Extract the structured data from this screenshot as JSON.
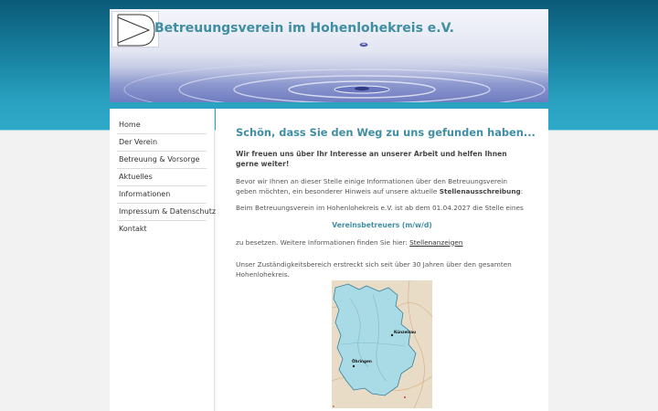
{
  "header": {
    "title": "Betreuungsverein im Hohenlohekreis e.V."
  },
  "nav": {
    "items": [
      {
        "label": "Home"
      },
      {
        "label": "Der Verein"
      },
      {
        "label": "Betreuung & Vorsorge"
      },
      {
        "label": "Aktuelles"
      },
      {
        "label": "Informationen"
      },
      {
        "label": "Impressum & Datenschutz"
      },
      {
        "label": "Kontakt"
      }
    ]
  },
  "main": {
    "heading": "Schön, dass Sie den Weg zu uns gefunden haben...",
    "lead": "Wir freuen uns über Ihr Interesse an unserer Arbeit und helfen Ihnen gerne weiter!",
    "para1_text": "Bevor wir Ihnen an dieser Stelle einige Informationen über den Betreuungsverein geben möchten, ein besonderer Hinweis auf unsere aktuelle ",
    "para1_bold": "Stellenausschreibung",
    "para1_end": ":",
    "para2": "Beim Betreuungsverein im Hohenlohekreis e.V. ist ab dem 01.04.2027 die Stelle eines",
    "job_title": "Vereinsbetreuers (m/w/d)",
    "para3_text": "zu besetzen. Weitere Informationen finden Sie hier: ",
    "para3_link": "Stellenanzeigen",
    "para4": "Unser Zuständigkeitsbereich erstreckt sich seit über 30 Jahren über den gesamten Hohenlohekreis.",
    "map": {
      "label_1": "Künzelsau",
      "label_2": "Öhringen"
    }
  },
  "colors": {
    "accent": "#3f8ea3",
    "header_bg_top": "#0a5a78",
    "map_fill": "#a9dbe6"
  }
}
